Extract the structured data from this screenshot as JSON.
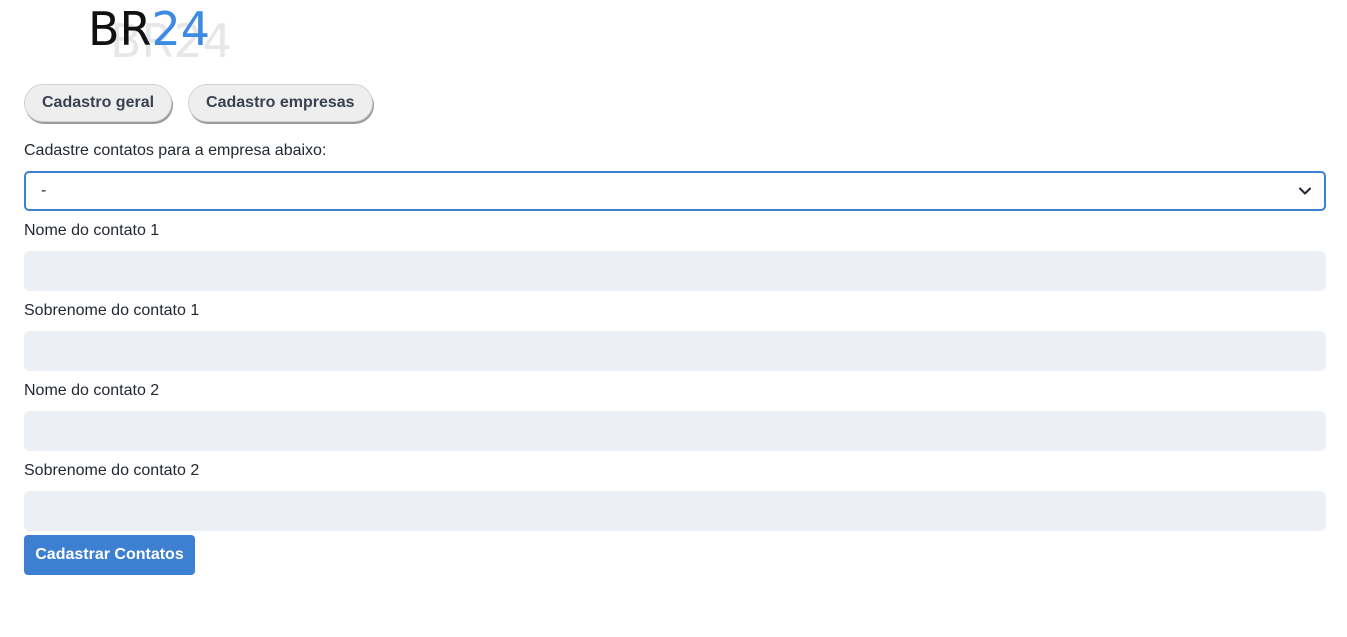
{
  "logo": {
    "text_br": "BR",
    "text_num": "24",
    "shadow_text": "BR24",
    "colors": {
      "br": "#111111",
      "num": "#3d8ae3",
      "shadow": "#e6e7e9"
    }
  },
  "tabs": [
    {
      "label": "Cadastro geral"
    },
    {
      "label": "Cadastro empresas"
    }
  ],
  "form": {
    "company_label": "Cadastre contatos para a empresa abaixo:",
    "company_select_value": "-",
    "fields": [
      {
        "label": "Nome do contato 1",
        "value": ""
      },
      {
        "label": "Sobrenome do contato 1",
        "value": ""
      },
      {
        "label": "Nome do contato 2",
        "value": ""
      },
      {
        "label": "Sobrenome do contato 2",
        "value": ""
      }
    ],
    "submit_label": "Cadastrar Contatos"
  },
  "icons": {
    "select_arrow": "chevron-down-icon"
  },
  "colors": {
    "accent": "#3d7fd0",
    "input_bg": "#ecf0f4",
    "tab_bg": "#eeeeef",
    "text": "#222831"
  }
}
